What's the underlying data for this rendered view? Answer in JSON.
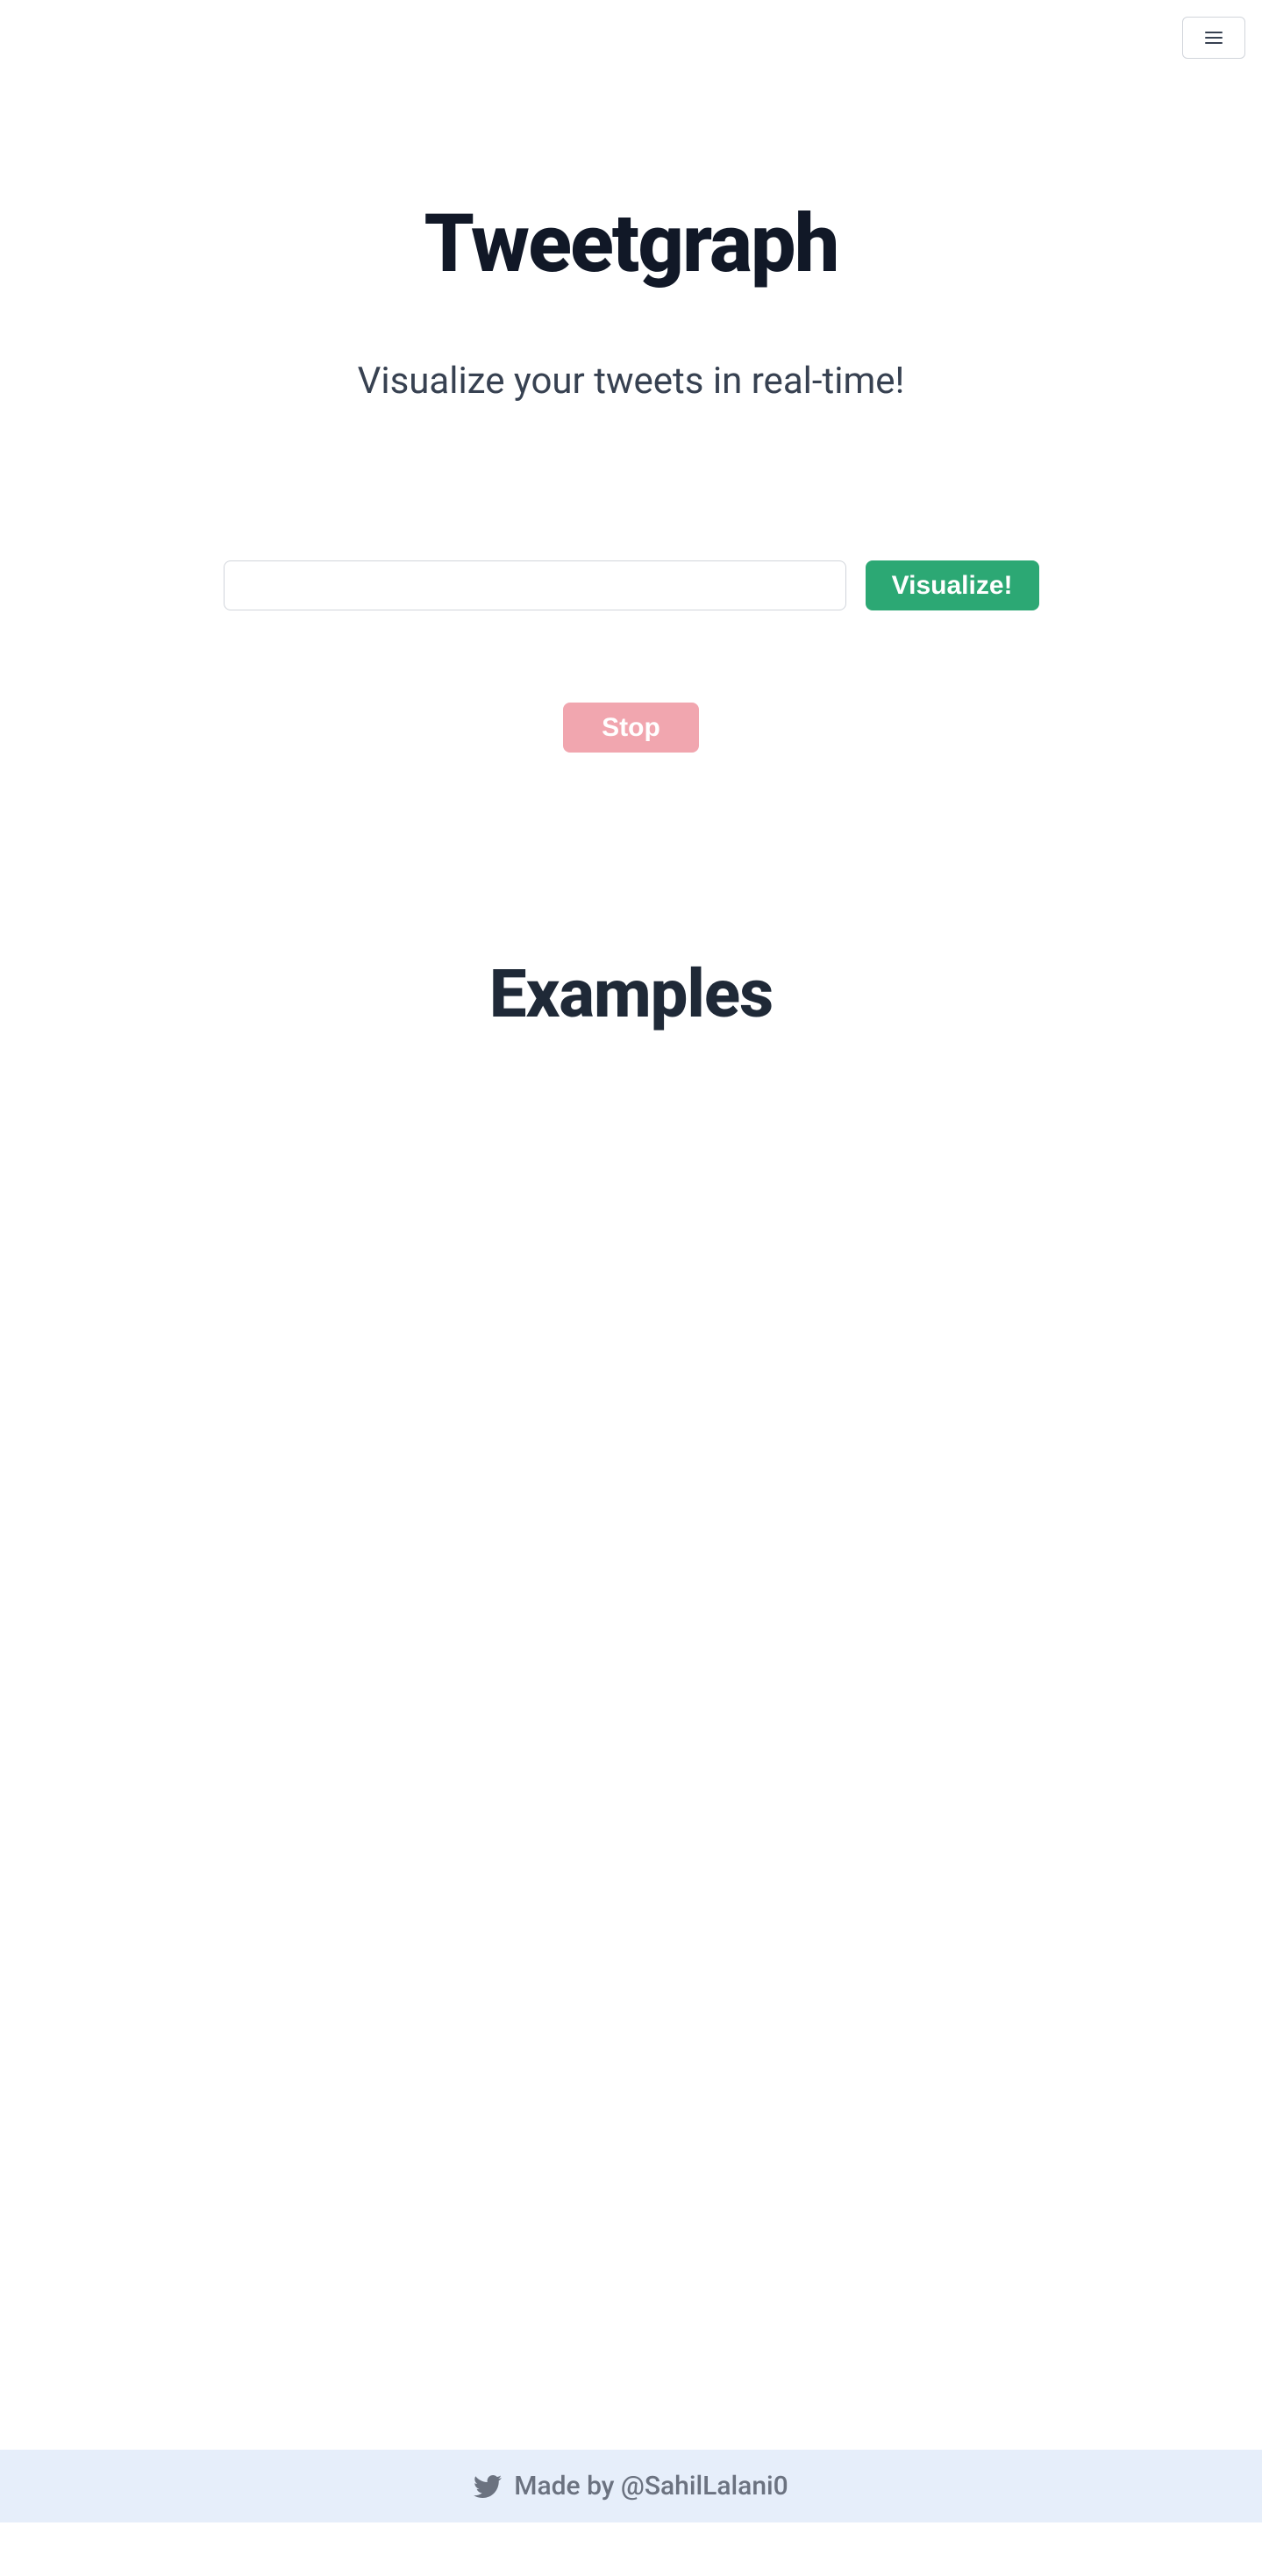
{
  "header": {
    "menu_label": "Menu"
  },
  "hero": {
    "title": "Tweetgraph",
    "subtitle": "Visualize your tweets in real-time!"
  },
  "form": {
    "input_value": "",
    "input_placeholder": "",
    "visualize_label": "Visualize!",
    "stop_label": "Stop"
  },
  "examples": {
    "heading": "Examples"
  },
  "footer": {
    "credit_text": "Made by @SahilLalani0"
  },
  "colors": {
    "primary_green": "#2ca874",
    "disabled_red": "#f1a6af",
    "footer_bg": "#e6eefa",
    "text_dark": "#1f2937",
    "text_muted": "#6b7280"
  }
}
